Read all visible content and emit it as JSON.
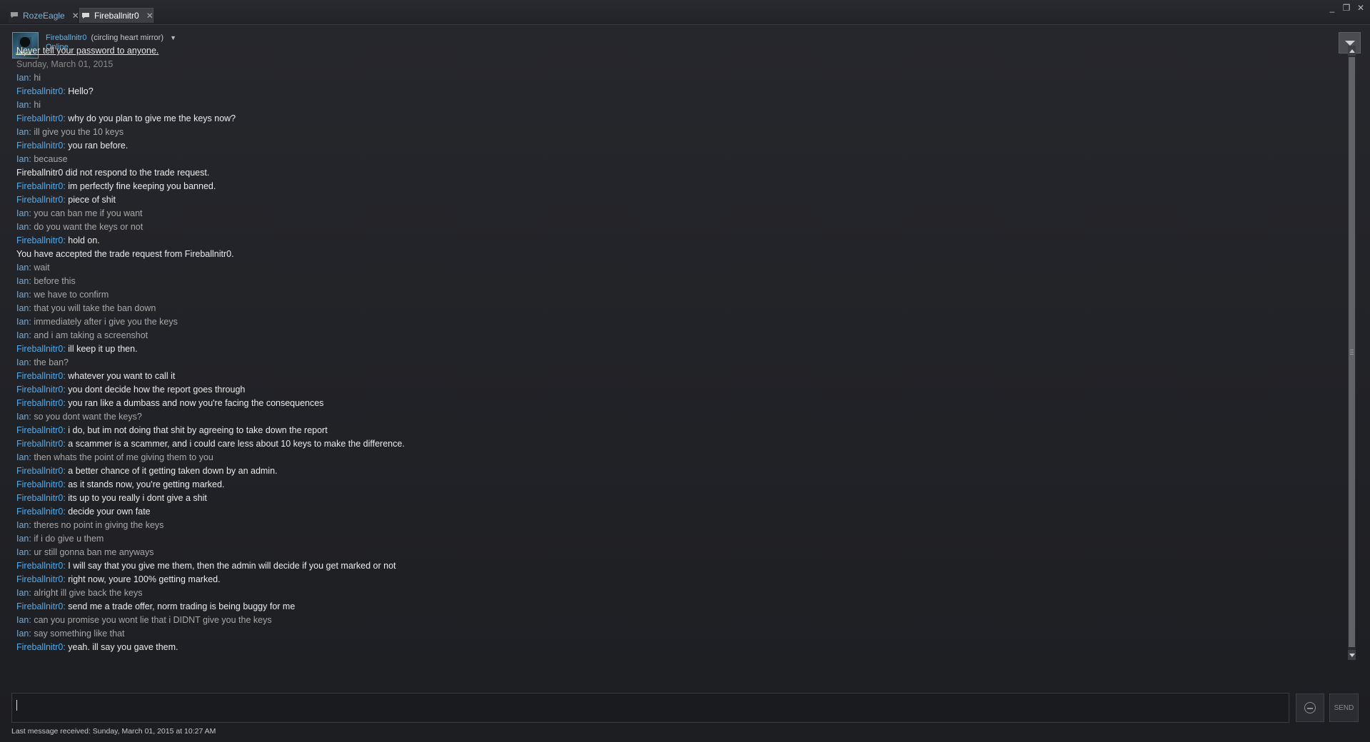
{
  "tabs": [
    {
      "label": "RozeEagle",
      "active": false
    },
    {
      "label": "Fireballnitr0",
      "active": true
    }
  ],
  "window_controls": {
    "minimize": "_",
    "maximize": "❐",
    "close": "✕"
  },
  "friend": {
    "name": "Fireballnitr0",
    "nickname": "(circling heart mirror)",
    "status": "Online",
    "avatar_tag": "aaRySe"
  },
  "warning": "Never tell your password to anyone.",
  "date_separator": "Sunday, March 01, 2015",
  "messages": [
    {
      "type": "chat",
      "sender": "Ian",
      "text": "hi"
    },
    {
      "type": "chat",
      "sender": "Fireballnitr0",
      "text": "Hello?"
    },
    {
      "type": "chat",
      "sender": "Ian",
      "text": "hi"
    },
    {
      "type": "chat",
      "sender": "Fireballnitr0",
      "text": "why do you plan to give me the keys now?"
    },
    {
      "type": "chat",
      "sender": "Ian",
      "text": "ill give you the 10 keys"
    },
    {
      "type": "chat",
      "sender": "Fireballnitr0",
      "text": "you ran before."
    },
    {
      "type": "chat",
      "sender": "Ian",
      "text": "because"
    },
    {
      "type": "system",
      "text": "Fireballnitr0 did not respond to the trade request."
    },
    {
      "type": "chat",
      "sender": "Fireballnitr0",
      "text": "im perfectly fine keeping you banned."
    },
    {
      "type": "chat",
      "sender": "Fireballnitr0",
      "text": "piece of shit"
    },
    {
      "type": "chat",
      "sender": "Ian",
      "text": "you can ban me if you want"
    },
    {
      "type": "chat",
      "sender": "Ian",
      "text": "do you want the keys or not"
    },
    {
      "type": "chat",
      "sender": "Fireballnitr0",
      "text": "hold on."
    },
    {
      "type": "system",
      "text": "You have accepted the trade request from Fireballnitr0."
    },
    {
      "type": "chat",
      "sender": "Ian",
      "text": "wait"
    },
    {
      "type": "chat",
      "sender": "Ian",
      "text": "before this"
    },
    {
      "type": "chat",
      "sender": "Ian",
      "text": "we have to confirm"
    },
    {
      "type": "chat",
      "sender": "Ian",
      "text": "that you will take the ban down"
    },
    {
      "type": "chat",
      "sender": "Ian",
      "text": "immediately after i give you the keys"
    },
    {
      "type": "chat",
      "sender": "Ian",
      "text": "and i am taking a screenshot"
    },
    {
      "type": "chat",
      "sender": "Fireballnitr0",
      "text": "ill keep it up then."
    },
    {
      "type": "chat",
      "sender": "Ian",
      "text": "the ban?"
    },
    {
      "type": "chat",
      "sender": "Fireballnitr0",
      "text": "whatever you want to call it"
    },
    {
      "type": "chat",
      "sender": "Fireballnitr0",
      "text": "you dont decide how the report goes through"
    },
    {
      "type": "chat",
      "sender": "Fireballnitr0",
      "text": "you ran like a dumbass and now you're facing the consequences"
    },
    {
      "type": "chat",
      "sender": "Ian",
      "text": "so you dont want the keys?"
    },
    {
      "type": "chat",
      "sender": "Fireballnitr0",
      "text": "i do, but im not doing that shit by agreeing to take down the report"
    },
    {
      "type": "chat",
      "sender": "Fireballnitr0",
      "text": "a scammer is a scammer, and i could care less about 10 keys to make the difference."
    },
    {
      "type": "chat",
      "sender": "Ian",
      "text": "then whats the point of me giving them to you"
    },
    {
      "type": "chat",
      "sender": "Fireballnitr0",
      "text": "a better chance of it getting taken down by an admin."
    },
    {
      "type": "chat",
      "sender": "Fireballnitr0",
      "text": "as it stands now, you're getting marked."
    },
    {
      "type": "chat",
      "sender": "Fireballnitr0",
      "text": "its up to you really i dont give a shit"
    },
    {
      "type": "chat",
      "sender": "Fireballnitr0",
      "text": "decide your own fate"
    },
    {
      "type": "chat",
      "sender": "Ian",
      "text": "theres no point in giving the keys"
    },
    {
      "type": "chat",
      "sender": "Ian",
      "text": "if i do give u them"
    },
    {
      "type": "chat",
      "sender": "Ian",
      "text": "ur still gonna ban me anyways"
    },
    {
      "type": "chat",
      "sender": "Fireballnitr0",
      "text": "I will say that you give me them, then the admin will decide if you get marked or not"
    },
    {
      "type": "chat",
      "sender": "Fireballnitr0",
      "text": "right now, youre 100% getting marked."
    },
    {
      "type": "chat",
      "sender": "Ian",
      "text": "alright ill give back the keys"
    },
    {
      "type": "chat",
      "sender": "Fireballnitr0",
      "text": "send me a trade offer, norm trading is being buggy for me"
    },
    {
      "type": "chat",
      "sender": "Ian",
      "text": "can you promise you wont lie that i DIDNT give you the keys"
    },
    {
      "type": "chat",
      "sender": "Ian",
      "text": "say something like that"
    },
    {
      "type": "chat",
      "sender": "Fireballnitr0",
      "text": "yeah. ill say you gave them."
    }
  ],
  "input": {
    "value": ""
  },
  "send_label": "SEND",
  "footer": "Last message received: Sunday, March 01, 2015 at 10:27 AM",
  "colors": {
    "background": "#1f2024",
    "friend_name": "#57a9e6",
    "self_name": "#7fa8cc",
    "friend_text": "#ececec",
    "self_text": "#a8a8a8"
  }
}
